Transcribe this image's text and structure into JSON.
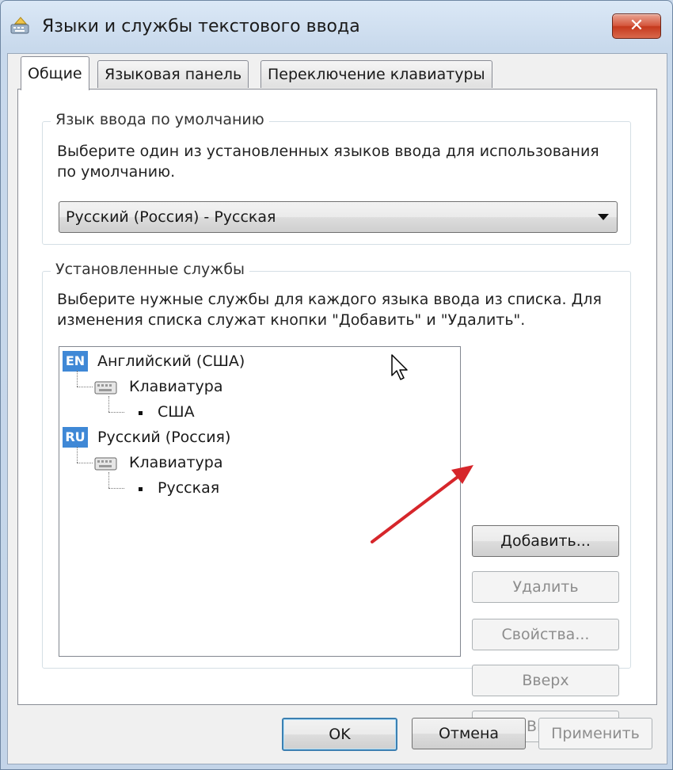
{
  "window": {
    "title": "Языки и службы текстового ввода",
    "close_glyph": "✕",
    "app_icon": "keyboard-settings-icon"
  },
  "tabs": [
    {
      "label": "Общие",
      "active": true
    },
    {
      "label": "Языковая панель",
      "active": false
    },
    {
      "label": "Переключение клавиатуры",
      "active": false
    }
  ],
  "default_language": {
    "legend": "Язык ввода по умолчанию",
    "description_line1": "Выберите один из установленных языков ввода для использования",
    "description_line2": "по умолчанию.",
    "selected": "Русский (Россия) - Русская"
  },
  "installed_services": {
    "legend": "Установленные службы",
    "description_line1": "Выберите нужные службы для каждого языка ввода из списка. Для",
    "description_line2": "изменения списка служат кнопки \"Добавить\" и \"Удалить\".",
    "languages": [
      {
        "badge": "EN",
        "name": "Английский (США)",
        "category": "Клавиатура",
        "layout": "США"
      },
      {
        "badge": "RU",
        "name": "Русский (Россия)",
        "category": "Клавиатура",
        "layout": "Русская"
      }
    ],
    "buttons": {
      "add": "Добавить...",
      "remove": "Удалить",
      "properties": "Свойства...",
      "up": "Вверх",
      "down": "Вниз"
    }
  },
  "footer": {
    "ok": "OK",
    "cancel": "Отмена",
    "apply": "Применить"
  },
  "colors": {
    "annotation_arrow": "#d6262b",
    "lang_badge": "#3f88d6",
    "close_button": "#c5391d"
  }
}
